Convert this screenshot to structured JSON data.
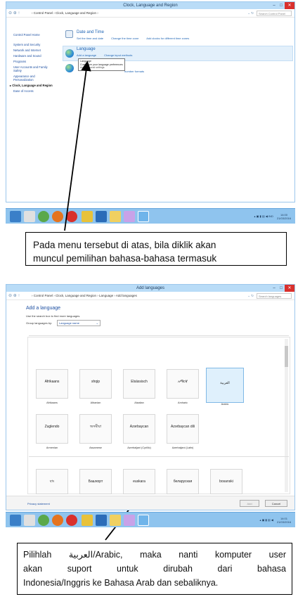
{
  "window1": {
    "title": "Clock, Language and Region",
    "address_path": "› Control Panel › Clock, Language and Region ›",
    "search_placeholder": "Search Control Panel",
    "sidebar": [
      "Control Panel Home",
      "System and Security",
      "Network and Internet",
      "Hardware and Sound",
      "Programs",
      "User Accounts and Family",
      "Safety",
      "Appearance and",
      "Personalization",
      "Clock, Language and Region",
      "Ease of Access"
    ],
    "date_time": {
      "title": "Date and Time",
      "links": [
        "Set the time and date",
        "Change the time zone",
        "Add clocks for different time zones"
      ]
    },
    "language": {
      "title": "Language",
      "links": [
        "Add a language",
        "Change input methods"
      ]
    },
    "tooltip_lines": [
      "Language",
      "Customize your language preferences"
    ],
    "region_link_partial": "Add personal settings",
    "region_tail": "number formats"
  },
  "taskbar1": {
    "time": "14:00",
    "date": "21/03/2016",
    "tray": "▴ ▣ ▮ ▤ ◀ IND"
  },
  "caption1": {
    "line1": "Pada menu tersebut di atas, bila diklik akan",
    "line2": "muncul pemilihan bahasa-bahasa termasuk"
  },
  "window2": {
    "title": "Add languages",
    "address_path": "› Control Panel › Clock, Language and Region › Language › Add languages",
    "search_placeholder": "Search languages",
    "heading": "Add a language",
    "subtitle": "Use the search box to find more languages.",
    "group_label": "Group languages by:",
    "group_value": "Language name",
    "row1": [
      {
        "native": "Afrikaans",
        "name": "Afrikaans"
      },
      {
        "native": "shqip",
        "name": "Albanian"
      },
      {
        "native": "Elsässisch",
        "name": "Alsatian"
      },
      {
        "native": "አማርኛ",
        "name": "Amharic"
      },
      {
        "native": "العربية",
        "name": "Arabic"
      }
    ],
    "row2": [
      {
        "native": "Zuglendo",
        "name": "Armenian"
      },
      {
        "native": "অসমীয়া",
        "name": "Assamese"
      },
      {
        "native": "Azərbaycan",
        "name": "Azerbaijani (Cyrillic)"
      },
      {
        "native": "Azərbaycan dili",
        "name": "Azerbaijani (Latin)"
      }
    ],
    "row3": [
      {
        "native": "বাং",
        "name": ""
      },
      {
        "native": "Башҡорт",
        "name": ""
      },
      {
        "native": "euskara",
        "name": ""
      },
      {
        "native": "беларуская",
        "name": ""
      },
      {
        "native": "bosanski",
        "name": ""
      }
    ],
    "privacy": "Privacy statement",
    "add_button": "Add",
    "cancel_button": "Cancel"
  },
  "taskbar2": {
    "time": "14:01",
    "date": "21/03/2016",
    "tray": "▴ ▣ ▮ ▤ ◀"
  },
  "caption2": {
    "line1": "Pilihlah العربية/Arabic, maka nanti komputer user",
    "line2": "akan suport untuk dirubah dari bahasa",
    "line3": "Indonesia/Inggris ke Bahasa Arab dan sebaliknya."
  }
}
